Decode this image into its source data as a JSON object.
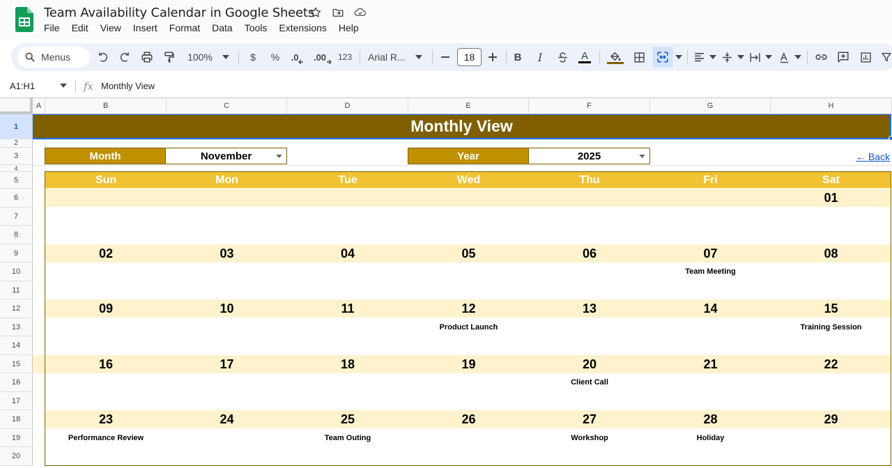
{
  "app": {
    "title": "Team Availability Calendar in Google Sheets",
    "menu": [
      "File",
      "Edit",
      "View",
      "Insert",
      "Format",
      "Data",
      "Tools",
      "Extensions",
      "Help"
    ]
  },
  "toolbar": {
    "search_label": "Menus",
    "zoom": "100%",
    "currency": "$",
    "percent": "%",
    "decrease_decimal": ".0",
    "increase_decimal": ".00",
    "number_format": "123",
    "font": "Arial R...",
    "font_size": "18",
    "bold": "B",
    "italic": "I",
    "text_color": "A"
  },
  "formula_bar": {
    "range": "A1:H1",
    "fx": "fx",
    "content": "Monthly View"
  },
  "grid": {
    "columns": [
      "A",
      "B",
      "C",
      "D",
      "E",
      "F",
      "G",
      "H"
    ],
    "rows": [
      "1",
      "2",
      "3",
      "4",
      "5",
      "6",
      "7",
      "8",
      "9",
      "10",
      "11",
      "12",
      "13",
      "14",
      "15",
      "16",
      "17",
      "18",
      "19",
      "20"
    ]
  },
  "sheet": {
    "banner": "Monthly View",
    "month_label": "Month",
    "month_value": "November",
    "year_label": "Year",
    "year_value": "2025",
    "back_link": "← Back"
  },
  "calendar": {
    "day_headers": [
      "Sun",
      "Mon",
      "Tue",
      "Wed",
      "Thu",
      "Fri",
      "Sat"
    ],
    "weeks": [
      {
        "dates": [
          "",
          "",
          "",
          "",
          "",
          "",
          "01"
        ],
        "events": [
          "",
          "",
          "",
          "",
          "",
          "",
          ""
        ]
      },
      {
        "dates": [
          "02",
          "03",
          "04",
          "05",
          "06",
          "07",
          "08"
        ],
        "events": [
          "",
          "",
          "",
          "",
          "",
          "Team Meeting",
          ""
        ]
      },
      {
        "dates": [
          "09",
          "10",
          "11",
          "12",
          "13",
          "14",
          "15"
        ],
        "events": [
          "",
          "",
          "",
          "Product Launch",
          "",
          "",
          "Training Session"
        ]
      },
      {
        "dates": [
          "16",
          "17",
          "18",
          "19",
          "20",
          "21",
          "22"
        ],
        "events": [
          "",
          "",
          "",
          "",
          "Client Call",
          "",
          ""
        ]
      },
      {
        "dates": [
          "23",
          "24",
          "25",
          "26",
          "27",
          "28",
          "29"
        ],
        "events": [
          "Performance Review",
          "",
          "Team Outing",
          "",
          "Workshop",
          "Holiday",
          ""
        ]
      }
    ]
  },
  "colors": {
    "banner_bg": "#7f5f00",
    "label_bg": "#bf9000",
    "day_header_bg": "#f1c232",
    "date_band_bg": "#fff2cc",
    "link": "#1155cc"
  }
}
